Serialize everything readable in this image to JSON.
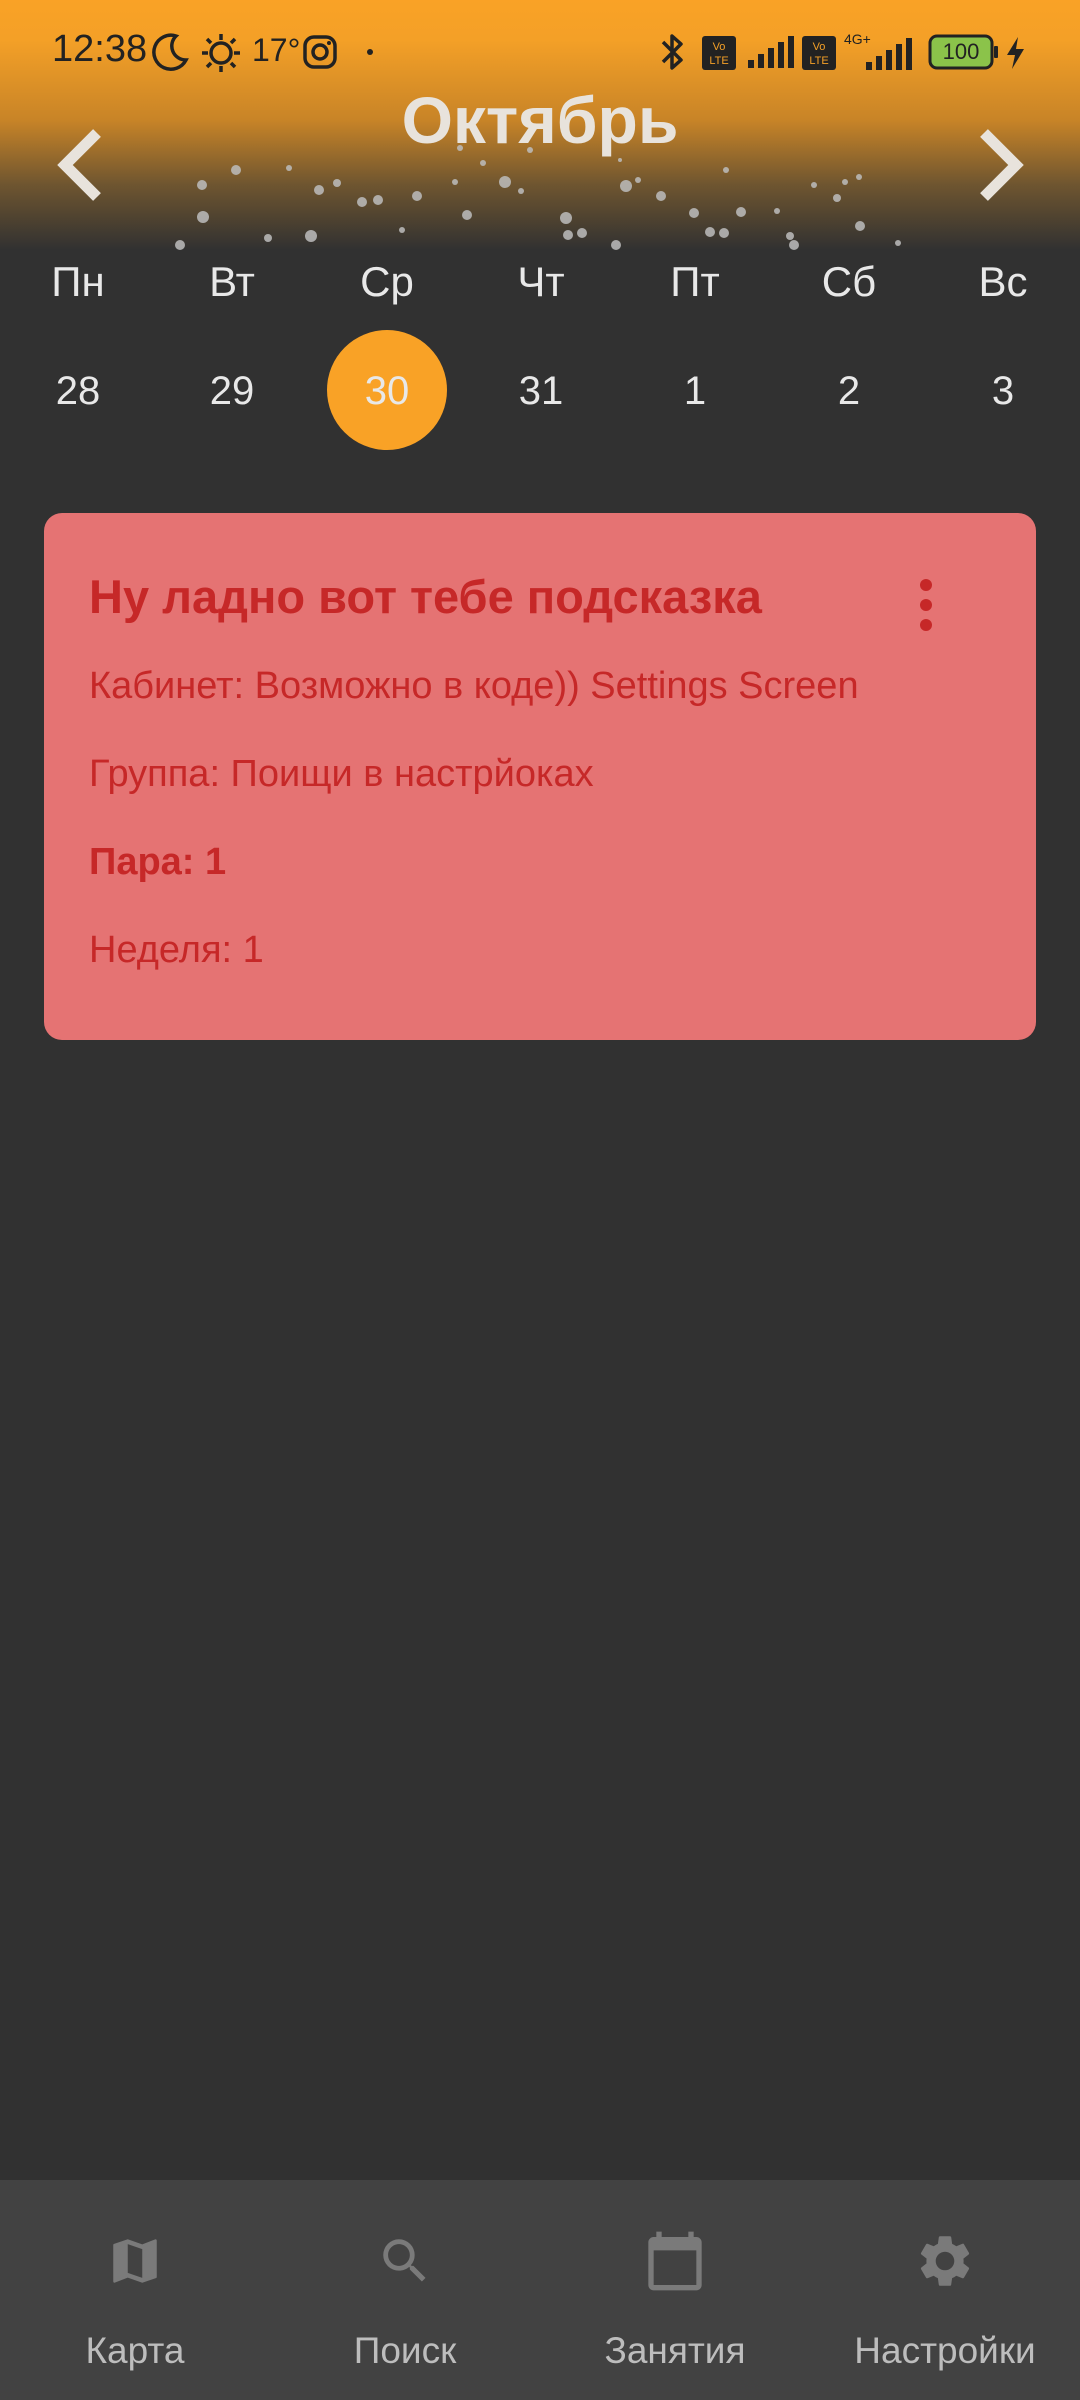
{
  "status_bar": {
    "time": "12:38",
    "temperature": "17°",
    "battery": "100"
  },
  "calendar": {
    "month": "Октябрь",
    "weekdays": [
      "Пн",
      "Вт",
      "Ср",
      "Чт",
      "Пт",
      "Сб",
      "Вс"
    ],
    "dates": [
      "28",
      "29",
      "30",
      "31",
      "1",
      "2",
      "3"
    ],
    "selected_date": "30"
  },
  "lesson_card": {
    "title": "Ну ладно вот тебе подсказка",
    "room": "Кабинет: Возможно в коде)) Settings Screen",
    "group": "Группа: Поищи в настрйоках",
    "pair": "Пара: 1",
    "week": "Неделя: 1"
  },
  "bottom_nav": {
    "items": [
      {
        "label": "Карта",
        "icon": "map-icon"
      },
      {
        "label": "Поиск",
        "icon": "search-icon"
      },
      {
        "label": "Занятия",
        "icon": "calendar-icon"
      },
      {
        "label": "Настройки",
        "icon": "gear-icon"
      }
    ]
  },
  "colors": {
    "accent": "#F9A226",
    "background": "#313131",
    "card": "#E57373",
    "card_text": "#C62828",
    "bottom_nav": "#424242"
  }
}
